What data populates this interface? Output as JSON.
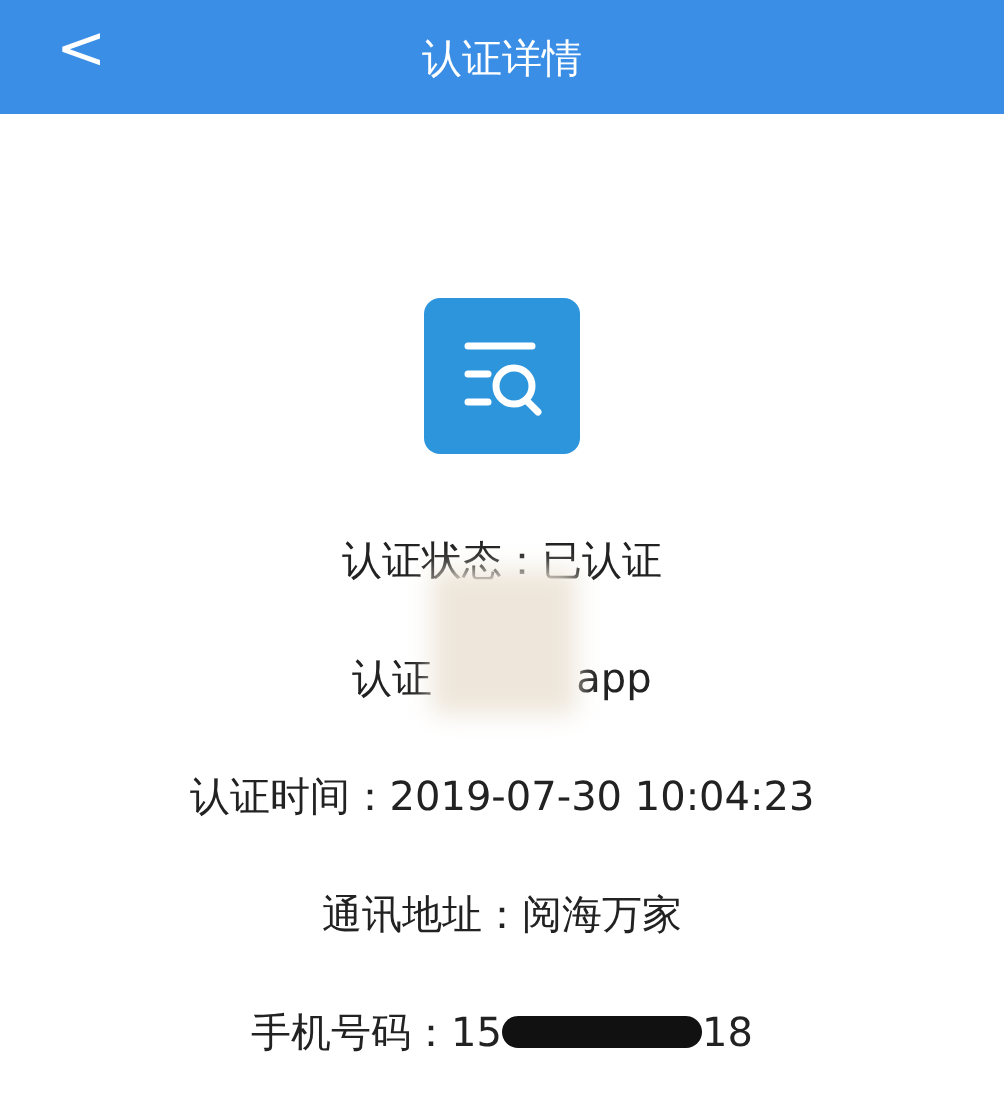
{
  "nav_bar": {
    "back": "<",
    "title": "认证详情"
  },
  "rows": [
    {
      "parts": [
        {
          "kind": "text",
          "text": "认证状态：已认证"
        }
      ]
    },
    {
      "parts": [
        {
          "kind": "text",
          "text": "认证"
        },
        {
          "kind": "blur"
        },
        {
          "kind": "text",
          "text": "app"
        }
      ]
    },
    {
      "parts": [
        {
          "kind": "text",
          "text": "认证时间：2019-07-30 10:04:23"
        }
      ]
    },
    {
      "parts": [
        {
          "kind": "text",
          "text": "通讯地址：阅海万家"
        }
      ]
    },
    {
      "parts": [
        {
          "kind": "text",
          "text": "手机号码：15"
        },
        {
          "kind": "ink"
        },
        {
          "kind": "text",
          "text": "18"
        }
      ]
    }
  ]
}
